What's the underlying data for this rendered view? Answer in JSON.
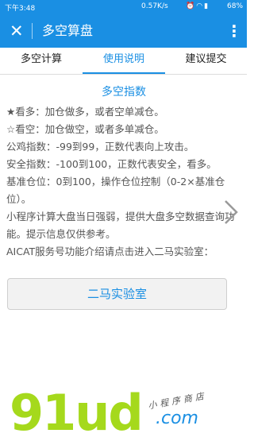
{
  "status": {
    "time": "下午3:48",
    "network_speed": "0.57K/s",
    "battery": "68%"
  },
  "header": {
    "title": "多空算盘"
  },
  "tabs": [
    {
      "label": "多空计算",
      "selected": false
    },
    {
      "label": "使用说明",
      "selected": true
    },
    {
      "label": "建议提交",
      "selected": false
    }
  ],
  "content": {
    "heading": "多空指数",
    "lines": [
      "★看多：加仓做多，或者空单减仓。",
      "☆看空：加仓做空，或者多单减仓。",
      "公鸡指数：-99到99，正数代表向上攻击。",
      "安全指数：-100到100，正数代表安全，看多。",
      "基准仓位：0到100，操作仓位控制（0-2×基准仓位）。",
      "小程序计算大盘当日强弱，提供大盘多空数据查询功能。提示信息仅供参考。",
      "AICAT服务号功能介绍请点击进入二马实验室："
    ],
    "lab_button": "二马实验室"
  },
  "watermark": {
    "brand": "91ud",
    "tagline": "小程序商店",
    "domain": ".com"
  },
  "colors": {
    "accent": "#1a8fe3",
    "watermark": "#a5d91c"
  }
}
